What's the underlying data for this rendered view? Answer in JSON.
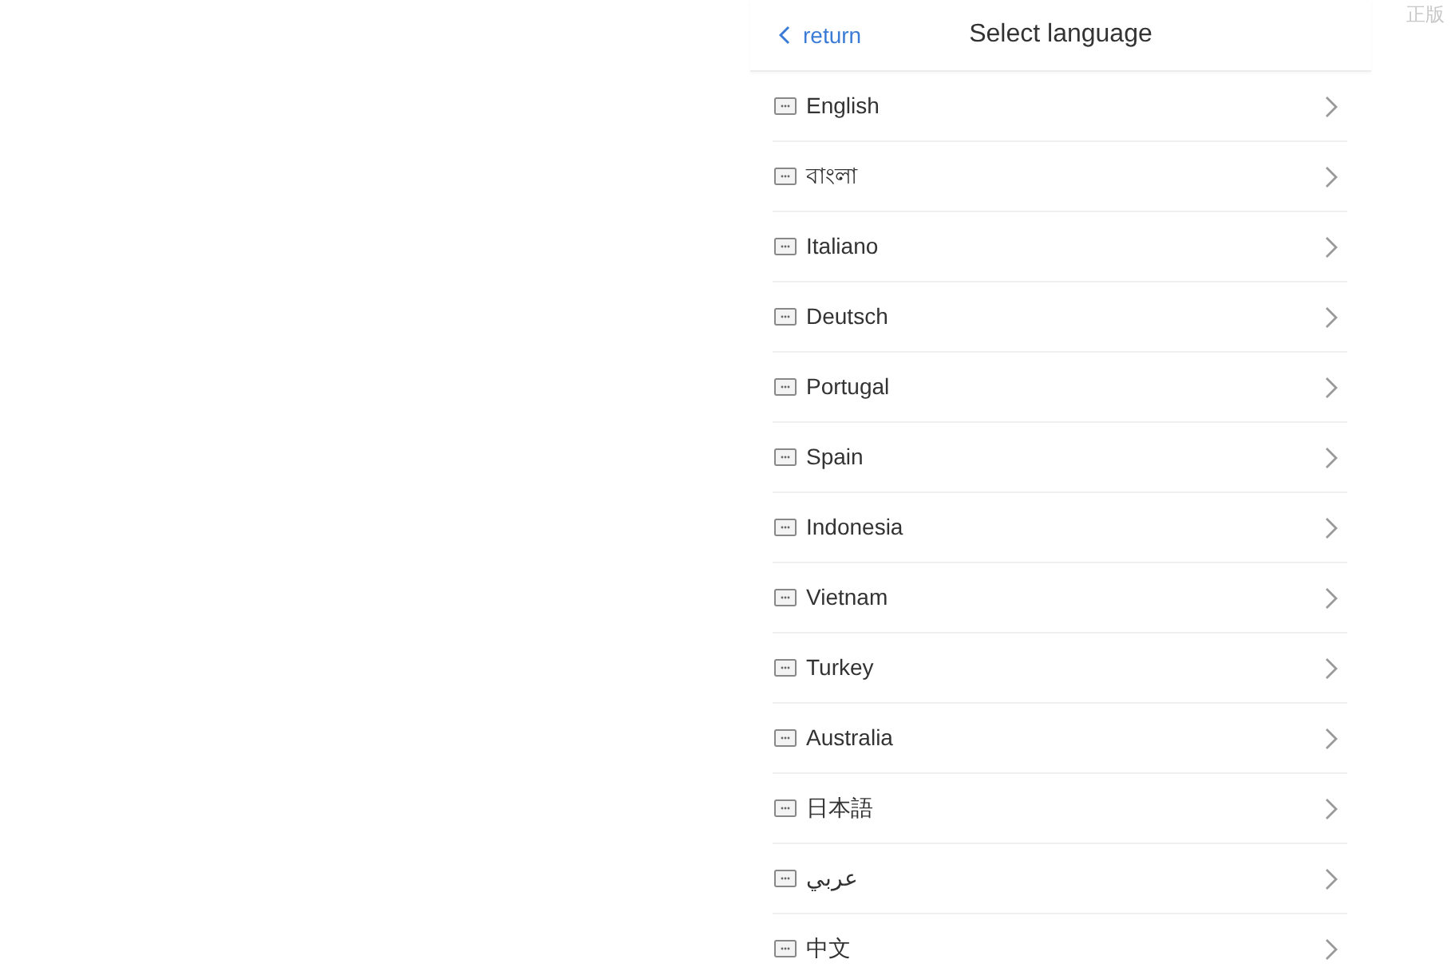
{
  "header": {
    "back_label": "return",
    "title": "Select language"
  },
  "corner_label": "正版",
  "languages": [
    {
      "label": "English"
    },
    {
      "label": "বাংলা"
    },
    {
      "label": "Italiano"
    },
    {
      "label": "Deutsch"
    },
    {
      "label": "Portugal"
    },
    {
      "label": "Spain"
    },
    {
      "label": "Indonesia"
    },
    {
      "label": "Vietnam"
    },
    {
      "label": "Turkey"
    },
    {
      "label": "Australia"
    },
    {
      "label": "日本語"
    },
    {
      "label": "عربي"
    },
    {
      "label": "中文"
    }
  ]
}
